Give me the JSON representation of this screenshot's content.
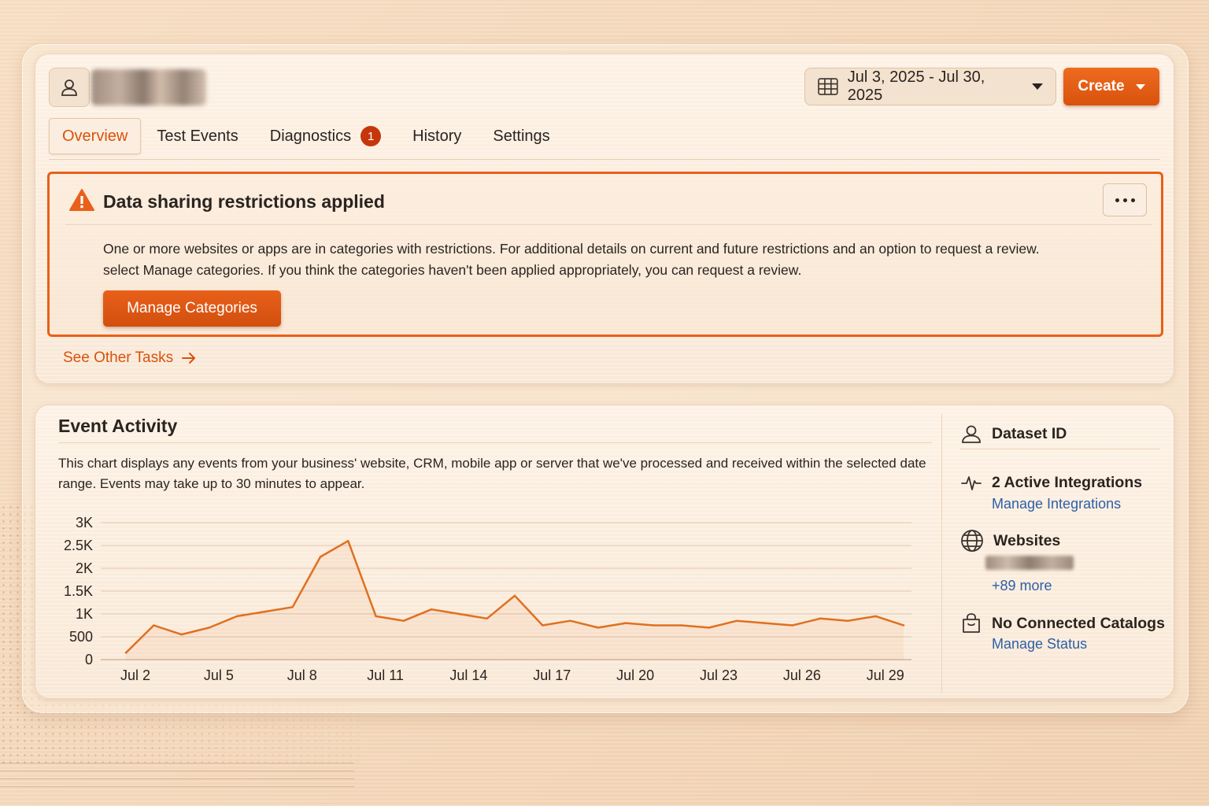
{
  "header": {
    "date_range": "Jul 3, 2025 - Jul 30, 2025",
    "create_label": "Create"
  },
  "tabs": [
    {
      "label": "Overview",
      "active": true
    },
    {
      "label": "Test Events"
    },
    {
      "label": "Diagnostics",
      "badge": "1"
    },
    {
      "label": "History"
    },
    {
      "label": "Settings"
    }
  ],
  "alert": {
    "title": "Data sharing restrictions applied",
    "body_line1": "One or more websites or apps are in categories with restrictions. For additional details on current and future restrictions and an option to request a review.",
    "body_line2": "select Manage categories. If you think the categories haven't been applied appropriately, you can request a review.",
    "button_label": "Manage Categories"
  },
  "see_other_tasks": "See Other Tasks",
  "event_activity": {
    "title": "Event Activity",
    "description": "This chart displays any events from your business' website, CRM, mobile app or server that we've processed and received within the selected date range. Events may take up to 30 minutes to appear."
  },
  "chart_data": {
    "type": "area",
    "x": [
      "Jul 2",
      "Jul 3",
      "Jul 4",
      "Jul 5",
      "Jul 6",
      "Jul 7",
      "Jul 8",
      "Jul 9",
      "Jul 10",
      "Jul 11",
      "Jul 12",
      "Jul 13",
      "Jul 14",
      "Jul 15",
      "Jul 16",
      "Jul 17",
      "Jul 18",
      "Jul 19",
      "Jul 20",
      "Jul 21",
      "Jul 22",
      "Jul 23",
      "Jul 24",
      "Jul 25",
      "Jul 26",
      "Jul 27",
      "Jul 28",
      "Jul 29",
      "Jul 30"
    ],
    "values": [
      150,
      750,
      550,
      700,
      950,
      1050,
      1150,
      2250,
      2600,
      950,
      850,
      1100,
      1000,
      900,
      1400,
      750,
      850,
      700,
      800,
      750,
      750,
      700,
      850,
      800,
      750,
      900,
      850,
      950,
      750
    ],
    "x_tick_labels": [
      "Jul 2",
      "Jul 5",
      "Jul 8",
      "Jul 11",
      "Jul 14",
      "Jul 17",
      "Jul 20",
      "Jul 23",
      "Jul 26",
      "Jul 29"
    ],
    "y_tick_labels": [
      "0",
      "500",
      "1K",
      "1.5K",
      "2K",
      "2.5K",
      "3K"
    ],
    "ylim": [
      0,
      3000
    ],
    "grid": true,
    "color": "#e07020"
  },
  "side_panel": {
    "dataset_label": "Dataset ID",
    "integrations_label": "2 Active Integrations",
    "integrations_link": "Manage Integrations",
    "websites_label": "Websites",
    "websites_more": "+89 more",
    "catalogs_label": "No Connected Catalogs",
    "catalogs_link": "Manage Status"
  },
  "colors": {
    "accent": "#d9520d",
    "link": "#2d5fa6",
    "badge": "#c5360c"
  }
}
